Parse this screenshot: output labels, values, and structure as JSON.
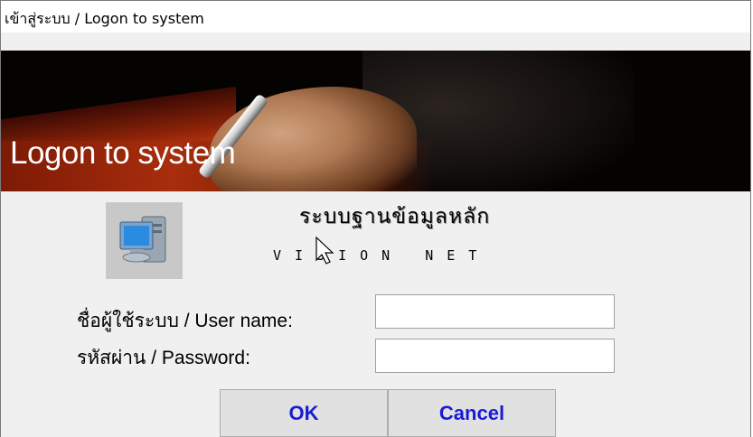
{
  "window": {
    "title": "เข้าสู่ระบบ / Logon to system"
  },
  "banner": {
    "title": "Logon to system"
  },
  "app": {
    "name": "ระบบฐานข้อมูลหลัก",
    "subtitle": "VISION NET",
    "icon": "computer-icon"
  },
  "form": {
    "username_label": "ชื่อผู้ใช้ระบบ / User name:",
    "username_value": "",
    "password_label": "รหัสผ่าน / Password:",
    "password_value": ""
  },
  "buttons": {
    "ok": "OK",
    "cancel": "Cancel"
  },
  "colors": {
    "button_text": "#1a1ad8",
    "background": "#f0f0f0"
  }
}
